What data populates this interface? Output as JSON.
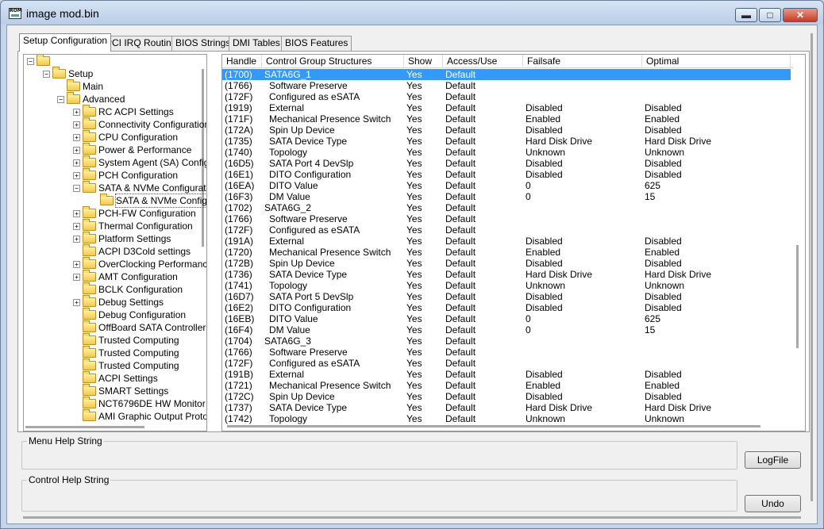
{
  "window": {
    "title": "image mod.bin",
    "icon_text": "ROM",
    "controls": [
      "minimize",
      "maximize",
      "close"
    ]
  },
  "tabs": [
    {
      "label": "Setup Configuration",
      "active": true
    },
    {
      "label": "PCI IRQ Routing",
      "active": false
    },
    {
      "label": "BIOS Strings",
      "active": false
    },
    {
      "label": "DMI Tables",
      "active": false
    },
    {
      "label": "BIOS Features",
      "active": false
    }
  ],
  "tree": [
    {
      "label": "",
      "depth": 0,
      "expander": "minus"
    },
    {
      "label": "Setup",
      "depth": 1,
      "expander": "minus"
    },
    {
      "label": "Main",
      "depth": 2,
      "expander": null
    },
    {
      "label": "Advanced",
      "depth": 2,
      "expander": "minus"
    },
    {
      "label": "RC ACPI Settings",
      "depth": 3,
      "expander": "plus"
    },
    {
      "label": "Connectivity Configuration",
      "depth": 3,
      "expander": "plus"
    },
    {
      "label": "CPU Configuration",
      "depth": 3,
      "expander": "plus"
    },
    {
      "label": "Power & Performance",
      "depth": 3,
      "expander": "plus"
    },
    {
      "label": "System Agent (SA) Configuration",
      "depth": 3,
      "expander": "plus"
    },
    {
      "label": "PCH Configuration",
      "depth": 3,
      "expander": "plus"
    },
    {
      "label": "SATA & NVMe Configuration",
      "depth": 3,
      "expander": "minus"
    },
    {
      "label": "SATA & NVMe Configuration",
      "depth": 4,
      "expander": null,
      "selected": true
    },
    {
      "label": "PCH-FW Configuration",
      "depth": 3,
      "expander": "plus"
    },
    {
      "label": "Thermal Configuration",
      "depth": 3,
      "expander": "plus"
    },
    {
      "label": "Platform Settings",
      "depth": 3,
      "expander": "plus"
    },
    {
      "label": "ACPI D3Cold settings",
      "depth": 3,
      "expander": null
    },
    {
      "label": "OverClocking Performance Menu",
      "depth": 3,
      "expander": "plus"
    },
    {
      "label": "AMT Configuration",
      "depth": 3,
      "expander": "plus"
    },
    {
      "label": "BCLK Configuration",
      "depth": 3,
      "expander": null
    },
    {
      "label": "Debug Settings",
      "depth": 3,
      "expander": "plus"
    },
    {
      "label": "Debug Configuration",
      "depth": 3,
      "expander": null
    },
    {
      "label": "OffBoard SATA Controller",
      "depth": 3,
      "expander": null
    },
    {
      "label": "Trusted Computing",
      "depth": 3,
      "expander": null
    },
    {
      "label": "Trusted Computing",
      "depth": 3,
      "expander": null
    },
    {
      "label": "Trusted Computing",
      "depth": 3,
      "expander": null
    },
    {
      "label": "ACPI Settings",
      "depth": 3,
      "expander": null
    },
    {
      "label": "SMART Settings",
      "depth": 3,
      "expander": null
    },
    {
      "label": "NCT6796DE HW Monitor",
      "depth": 3,
      "expander": null
    },
    {
      "label": "AMI Graphic Output Protocol Policy",
      "depth": 3,
      "expander": null
    }
  ],
  "grid": {
    "columns": [
      "Handle",
      "Control Group Structures",
      "Show",
      "Access/Use",
      "Failsafe",
      "Optimal"
    ],
    "rows": [
      {
        "handle": "(1700)",
        "name": "SATA6G_1",
        "indent": false,
        "show": "Yes",
        "access": "Default",
        "failsafe": "",
        "optimal": "",
        "selected": true
      },
      {
        "handle": "(1766)",
        "name": "Software Preserve",
        "indent": true,
        "show": "Yes",
        "access": "Default",
        "failsafe": "",
        "optimal": ""
      },
      {
        "handle": "(172F)",
        "name": "Configured as eSATA",
        "indent": true,
        "show": "Yes",
        "access": "Default",
        "failsafe": "",
        "optimal": ""
      },
      {
        "handle": "(1919)",
        "name": "External",
        "indent": true,
        "show": "Yes",
        "access": "Default",
        "failsafe": "Disabled",
        "optimal": "Disabled"
      },
      {
        "handle": "(171F)",
        "name": "Mechanical Presence Switch",
        "indent": true,
        "show": "Yes",
        "access": "Default",
        "failsafe": "Enabled",
        "optimal": "Enabled"
      },
      {
        "handle": "(172A)",
        "name": "Spin Up Device",
        "indent": true,
        "show": "Yes",
        "access": "Default",
        "failsafe": "Disabled",
        "optimal": "Disabled"
      },
      {
        "handle": "(1735)",
        "name": "SATA Device Type",
        "indent": true,
        "show": "Yes",
        "access": "Default",
        "failsafe": "Hard Disk Drive",
        "optimal": "Hard Disk Drive"
      },
      {
        "handle": "(1740)",
        "name": "Topology",
        "indent": true,
        "show": "Yes",
        "access": "Default",
        "failsafe": "Unknown",
        "optimal": "Unknown"
      },
      {
        "handle": "(16D5)",
        "name": "SATA Port 4 DevSlp",
        "indent": true,
        "show": "Yes",
        "access": "Default",
        "failsafe": "Disabled",
        "optimal": "Disabled"
      },
      {
        "handle": "(16E1)",
        "name": "DITO Configuration",
        "indent": true,
        "show": "Yes",
        "access": "Default",
        "failsafe": "Disabled",
        "optimal": "Disabled"
      },
      {
        "handle": "(16EA)",
        "name": "DITO Value",
        "indent": true,
        "show": "Yes",
        "access": "Default",
        "failsafe": "0",
        "optimal": "625"
      },
      {
        "handle": "(16F3)",
        "name": "DM Value",
        "indent": true,
        "show": "Yes",
        "access": "Default",
        "failsafe": "0",
        "optimal": "15"
      },
      {
        "handle": "(1702)",
        "name": "SATA6G_2",
        "indent": false,
        "show": "Yes",
        "access": "Default",
        "failsafe": "",
        "optimal": ""
      },
      {
        "handle": "(1766)",
        "name": "Software Preserve",
        "indent": true,
        "show": "Yes",
        "access": "Default",
        "failsafe": "",
        "optimal": ""
      },
      {
        "handle": "(172F)",
        "name": "Configured as eSATA",
        "indent": true,
        "show": "Yes",
        "access": "Default",
        "failsafe": "",
        "optimal": ""
      },
      {
        "handle": "(191A)",
        "name": "External",
        "indent": true,
        "show": "Yes",
        "access": "Default",
        "failsafe": "Disabled",
        "optimal": "Disabled"
      },
      {
        "handle": "(1720)",
        "name": "Mechanical Presence Switch",
        "indent": true,
        "show": "Yes",
        "access": "Default",
        "failsafe": "Enabled",
        "optimal": "Enabled"
      },
      {
        "handle": "(172B)",
        "name": "Spin Up Device",
        "indent": true,
        "show": "Yes",
        "access": "Default",
        "failsafe": "Disabled",
        "optimal": "Disabled"
      },
      {
        "handle": "(1736)",
        "name": "SATA Device Type",
        "indent": true,
        "show": "Yes",
        "access": "Default",
        "failsafe": "Hard Disk Drive",
        "optimal": "Hard Disk Drive"
      },
      {
        "handle": "(1741)",
        "name": "Topology",
        "indent": true,
        "show": "Yes",
        "access": "Default",
        "failsafe": "Unknown",
        "optimal": "Unknown"
      },
      {
        "handle": "(16D7)",
        "name": "SATA Port 5 DevSlp",
        "indent": true,
        "show": "Yes",
        "access": "Default",
        "failsafe": "Disabled",
        "optimal": "Disabled"
      },
      {
        "handle": "(16E2)",
        "name": "DITO Configuration",
        "indent": true,
        "show": "Yes",
        "access": "Default",
        "failsafe": "Disabled",
        "optimal": "Disabled"
      },
      {
        "handle": "(16EB)",
        "name": "DITO Value",
        "indent": true,
        "show": "Yes",
        "access": "Default",
        "failsafe": "0",
        "optimal": "625"
      },
      {
        "handle": "(16F4)",
        "name": "DM Value",
        "indent": true,
        "show": "Yes",
        "access": "Default",
        "failsafe": "0",
        "optimal": "15"
      },
      {
        "handle": "(1704)",
        "name": "SATA6G_3",
        "indent": false,
        "show": "Yes",
        "access": "Default",
        "failsafe": "",
        "optimal": ""
      },
      {
        "handle": "(1766)",
        "name": "Software Preserve",
        "indent": true,
        "show": "Yes",
        "access": "Default",
        "failsafe": "",
        "optimal": ""
      },
      {
        "handle": "(172F)",
        "name": "Configured as eSATA",
        "indent": true,
        "show": "Yes",
        "access": "Default",
        "failsafe": "",
        "optimal": ""
      },
      {
        "handle": "(191B)",
        "name": "External",
        "indent": true,
        "show": "Yes",
        "access": "Default",
        "failsafe": "Disabled",
        "optimal": "Disabled"
      },
      {
        "handle": "(1721)",
        "name": "Mechanical Presence Switch",
        "indent": true,
        "show": "Yes",
        "access": "Default",
        "failsafe": "Enabled",
        "optimal": "Enabled"
      },
      {
        "handle": "(172C)",
        "name": "Spin Up Device",
        "indent": true,
        "show": "Yes",
        "access": "Default",
        "failsafe": "Disabled",
        "optimal": "Disabled"
      },
      {
        "handle": "(1737)",
        "name": "SATA Device Type",
        "indent": true,
        "show": "Yes",
        "access": "Default",
        "failsafe": "Hard Disk Drive",
        "optimal": "Hard Disk Drive"
      },
      {
        "handle": "(1742)",
        "name": "Topology",
        "indent": true,
        "show": "Yes",
        "access": "Default",
        "failsafe": "Unknown",
        "optimal": "Unknown"
      }
    ]
  },
  "help": {
    "menu_label": "Menu Help String",
    "control_label": "Control Help String"
  },
  "buttons": {
    "logfile": "LogFile",
    "undo": "Undo"
  },
  "colors": {
    "selection": "#3399ff",
    "folder": "#f2c94c"
  }
}
